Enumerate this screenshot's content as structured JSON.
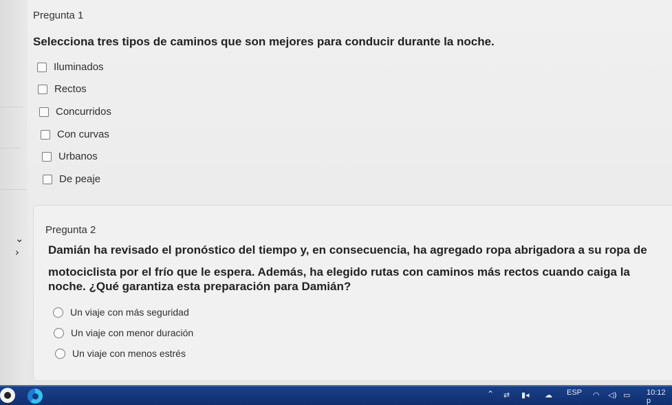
{
  "question1": {
    "title": "Pregunta 1",
    "text": "Selecciona tres tipos de caminos que son mejores para conducir durante la noche.",
    "options": [
      "Iluminados",
      "Rectos",
      "Concurridos",
      "Con curvas",
      "Urbanos",
      "De peaje"
    ]
  },
  "question2": {
    "title": "Pregunta 2",
    "text_lines": [
      "Damián ha revisado el pronóstico del tiempo y, en consecuencia, ha agregado ropa abrigadora a su ropa de",
      "motociclista por el frío que le espera. Además, ha elegido rutas con caminos más rectos cuando caiga la",
      "noche. ¿Qué garantiza esta preparación para Damián?"
    ],
    "options": [
      "Un viaje con más seguridad",
      "Un viaje con menor duración",
      "Un viaje con menos estrés"
    ]
  },
  "taskbar": {
    "language": "ESP",
    "time": "10:12 p",
    "tray_icons": [
      "chevron-up-icon",
      "network-icon",
      "media-icon",
      "onedrive-icon",
      "wifi-icon",
      "volume-icon",
      "battery-icon"
    ]
  },
  "colors": {
    "taskbar": "#12337a",
    "taskbar_accent": "#2a6fd6",
    "page_background": "#ececec"
  }
}
